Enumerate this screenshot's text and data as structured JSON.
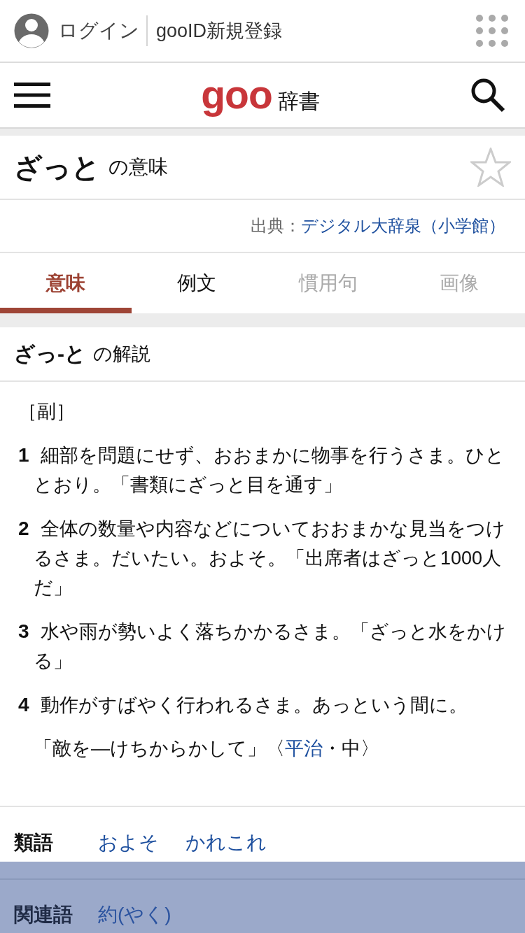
{
  "header_bar": {
    "login": "ログイン",
    "register": "gooID新規登録"
  },
  "nav": {
    "logo": "goo",
    "logo_suffix": "辞書"
  },
  "entry": {
    "word": "ざっと",
    "suffix": "の意味",
    "favorite": false
  },
  "source": {
    "label": "出典：",
    "link": "デジタル大辞泉（小学館）"
  },
  "tabs": [
    {
      "label": "意味",
      "selected": true,
      "disabled": false
    },
    {
      "label": "例文",
      "selected": false,
      "disabled": false
    },
    {
      "label": "慣用句",
      "selected": false,
      "disabled": true
    },
    {
      "label": "画像",
      "selected": false,
      "disabled": true
    }
  ],
  "explanation": {
    "headword": "ざっ-と",
    "suffix": "の解説",
    "part_of_speech": "［副］",
    "senses": [
      {
        "number": "1",
        "text": "細部を問題にせず、おおまかに物事を行うさま。ひととおり。「書類にざっと目を通す」"
      },
      {
        "number": "2",
        "text": "全体の数量や内容などについておおまかな見当をつけるさま。だいたい。およそ。「出席者はざっと1000人だ」"
      },
      {
        "number": "3",
        "text": "水や雨が勢いよく落ちかかるさま。「ざっと水をかける」"
      },
      {
        "number": "4",
        "text": "動作がすばやく行われるさま。あっという間に。",
        "example": {
          "before": "「敵を―けちからかして」〈",
          "link": "平治",
          "after": "・中〉"
        }
      }
    ]
  },
  "synonyms": {
    "label": "類語",
    "links": [
      "およそ",
      "かれこれ"
    ]
  },
  "related": {
    "label": "関連語",
    "links": [
      "約(やく)"
    ]
  }
}
